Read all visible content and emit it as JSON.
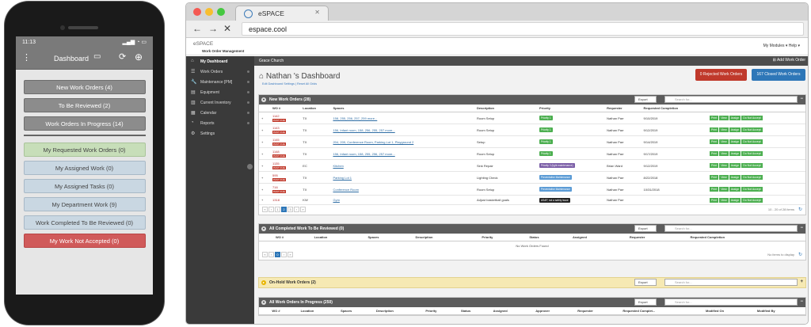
{
  "phone": {
    "time": "11:13",
    "header_title": "Dashboard",
    "group1": [
      "New Work Orders (4)",
      "To Be Reviewed (2)",
      "Work Orders In Progress (14)"
    ],
    "group2": [
      {
        "label": "My Requested Work Orders (0)",
        "style": "green"
      },
      {
        "label": "My Assigned Work (0)",
        "style": "blue"
      },
      {
        "label": "My Assigned Tasks (0)",
        "style": "blue"
      },
      {
        "label": "My Department Work (9)",
        "style": "blue"
      },
      {
        "label": "Work Completed To Be Reviewed (0)",
        "style": "blue"
      },
      {
        "label": "My Work Not Accepted (0)",
        "style": "red"
      }
    ]
  },
  "browser": {
    "tab_title": "eSPACE",
    "url": "espace.cool",
    "logo": "eSPACE",
    "logo_sub": "Work Order Management",
    "top_right": "My Modules ▾   Help ▾"
  },
  "sidebar": [
    "My Dashboard",
    "Work Orders",
    "Maintenance [PM]",
    "Equipment",
    "Current Inventory",
    "Calendar",
    "Reports",
    "Settings"
  ],
  "main": {
    "org": "Grace Church",
    "add_wo": "Add Work Order",
    "title": "Nathan 's Dashboard",
    "links": "Edit Dashboard Settings  |  Reset All Grids",
    "rejected_btn": "Rejected Work Orders",
    "rejected_count": "0",
    "closed_btn": "Closed Work Orders",
    "closed_count": "167",
    "export": "Export",
    "search_placeholder": "Search for...",
    "panel1": {
      "title": "New Work Orders (28)",
      "columns": [
        "WO #",
        "Location",
        "Spaces",
        "Description",
        "Priority",
        "Requester",
        "Requested Completion"
      ],
      "rows": [
        {
          "wo": "1142",
          "past": "PAST DUE",
          "loc": "TX",
          "spaces": "158, 255, 256, 257, 259 more...",
          "desc": "Room Setup",
          "pri": "Priority 1",
          "pricolor": "#4caf50",
          "req": "Nathan Parr",
          "date": "9/10/2019"
        },
        {
          "wo": "1143",
          "past": "PAST DUE",
          "loc": "TX",
          "spaces": "156, Infant room, 158, 256, 255, 257 more...",
          "desc": "Room Setup",
          "pri": "Priority 1",
          "pricolor": "#4caf50",
          "req": "Nathan Parr",
          "date": "9/12/2019"
        },
        {
          "wo": "1145",
          "past": "PAST DUE",
          "loc": "TX",
          "spaces": "204, 209, Conference Room, Parking Lot 1, Playground 2",
          "desc": "Setup",
          "pri": "Priority 1",
          "pricolor": "#4caf50",
          "req": "Nathan Parr",
          "date": "9/14/2019"
        },
        {
          "wo": "1148",
          "past": "PAST DUE",
          "loc": "TX",
          "spaces": "156, Infant room, 158, 255, 256, 257 more...",
          "desc": "Room Setup",
          "pri": "Priority 1",
          "pricolor": "#4caf50",
          "req": "Nathan Parr",
          "date": "9/17/2019"
        },
        {
          "wo": "1135",
          "past": "PAST DUE",
          "loc": "EC",
          "spaces": "Kitchen",
          "desc": "Sink Repair",
          "pri": "Priority 3 (light maintenance)",
          "pricolor": "#7b5ea7",
          "req": "Brian Ward",
          "date": "9/12/2019"
        },
        {
          "wo": "595",
          "past": "PAST DUE",
          "loc": "TX",
          "spaces": "Parking Lot 1",
          "desc": "Lighting Check",
          "pri": "Preventative Maintenance",
          "pricolor": "#5b9bd5",
          "req": "Nathan Parr",
          "date": "8/22/2018"
        },
        {
          "wo": "716",
          "past": "PAST DUE",
          "loc": "TX",
          "spaces": "Conference Room",
          "desc": "Room Setup",
          "pri": "Preventative Maintenance",
          "pricolor": "#5b9bd5",
          "req": "Nathan Parr",
          "date": "10/31/2018"
        },
        {
          "wo": "1318",
          "past": "",
          "loc": "KW",
          "spaces": "Gym",
          "desc": "Adjust basketball goals",
          "pri": "ASAP, not a safety issue",
          "pricolor": "#222",
          "req": "Nathan Parr",
          "date": ""
        }
      ],
      "actions": [
        "Print",
        "View",
        "Assign",
        "Do Not Accept"
      ],
      "pages": [
        "1",
        "2",
        "3"
      ],
      "page_info": "10 - 20 of 28 items"
    },
    "panel2": {
      "title": "All Completed Work To Be Reviewed (0)",
      "columns": [
        "WO #",
        "Location",
        "Spaces",
        "Description",
        "Priority",
        "Status",
        "Assigned",
        "Requester",
        "Requested Completion"
      ],
      "empty": "No Work Orders Found",
      "page_info": "No items to display"
    },
    "panel3": {
      "title": "On-Hold Work Orders (2)"
    },
    "panel4": {
      "title": "All Work Orders In Progress (250)",
      "columns": [
        "WO #",
        "Location",
        "Spaces",
        "Description",
        "Priority",
        "Status",
        "Assigned",
        "Approver",
        "Requester",
        "Requested Complet...",
        "Modified On",
        "Modified By"
      ]
    }
  },
  "colors": {
    "sidebar": "#3a3a3a",
    "panel_header": "#5c5c5c",
    "reject": "#c0392b",
    "closed": "#2e77b8",
    "action": "#4caf50"
  }
}
